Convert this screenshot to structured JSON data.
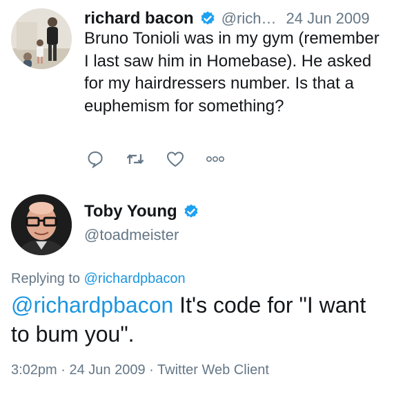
{
  "reply_context": {
    "author_name": "richard bacon",
    "handle": "@rich…",
    "date": "24 Jun 2009",
    "text": "Bruno Tonioli was in my gym (remember I last saw him in Homebase). He asked for my hairdressers number. Is that a euphemism for something?",
    "actions": [
      "reply-icon",
      "retweet-icon",
      "like-icon",
      "more-icon"
    ]
  },
  "tweet": {
    "author_name": "Toby Young",
    "handle": "@toadmeister",
    "replying_prefix": "Replying to ",
    "replying_to": "@richardpbacon",
    "mention": "@richardpbacon",
    "text": " It's code for \"I want to bum you\".",
    "time": "3:02pm",
    "sep1": " · ",
    "date": "24 Jun 2009",
    "sep2": " · ",
    "client": "Twitter Web Client"
  },
  "colors": {
    "accent": "#1b95e0",
    "verified": "#1da1f2",
    "secondary_text": "#657786",
    "primary_text": "#14171a"
  }
}
